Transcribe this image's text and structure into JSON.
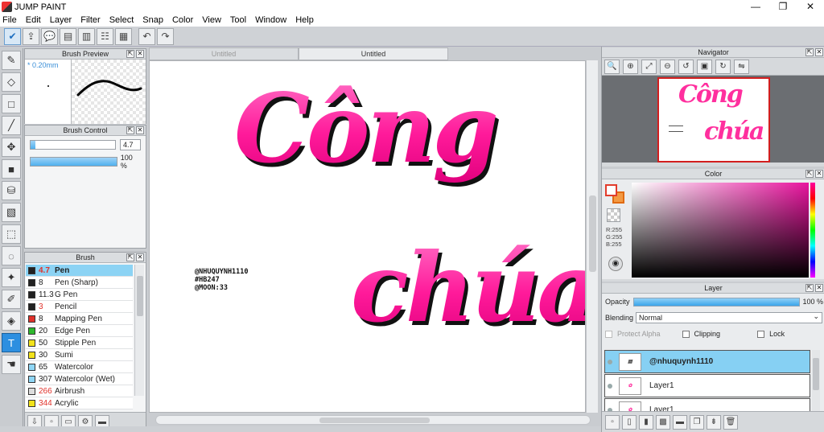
{
  "window": {
    "title": "JUMP PAINT",
    "controls": [
      "—",
      "❐",
      "✕"
    ]
  },
  "menu": [
    "File",
    "Edit",
    "Layer",
    "Filter",
    "Select",
    "Snap",
    "Color",
    "View",
    "Tool",
    "Window",
    "Help"
  ],
  "brush_preview": {
    "title": "Brush Preview",
    "size_label": "* 0.20mm"
  },
  "brush_control": {
    "title": "Brush Control",
    "size_value": "4.7",
    "size_fraction": 0.06,
    "opacity_label": "100 %",
    "opacity_fraction": 1.0
  },
  "brush_panel": {
    "title": "Brush",
    "items": [
      {
        "size": "4.7",
        "name": "Pen",
        "color": "#222222",
        "size_color": "#e0322b",
        "selected": true
      },
      {
        "size": "8",
        "name": "Pen (Sharp)",
        "color": "#222222",
        "size_color": "#222222"
      },
      {
        "size": "11.3",
        "name": "G Pen",
        "color": "#222222",
        "size_color": "#222222"
      },
      {
        "size": "3",
        "name": "Pencil",
        "color": "#222222",
        "size_color": "#e0322b"
      },
      {
        "size": "8",
        "name": "Mapping Pen",
        "color": "#e0322b",
        "size_color": "#222222"
      },
      {
        "size": "20",
        "name": "Edge Pen",
        "color": "#2db82d",
        "size_color": "#222222"
      },
      {
        "size": "50",
        "name": "Stipple Pen",
        "color": "#f2e21a",
        "size_color": "#222222"
      },
      {
        "size": "30",
        "name": "Sumi",
        "color": "#f2e21a",
        "size_color": "#222222"
      },
      {
        "size": "65",
        "name": "Watercolor",
        "color": "#8fd6f5",
        "size_color": "#222222"
      },
      {
        "size": "307",
        "name": "Watercolor (Wet)",
        "color": "#8fd6f5",
        "size_color": "#222222"
      },
      {
        "size": "266",
        "name": "Airbrush",
        "color": "#dddddd",
        "size_color": "#e0322b"
      },
      {
        "size": "344",
        "name": "Acrylic",
        "color": "#f2e21a",
        "size_color": "#e0322b"
      }
    ]
  },
  "tabs": [
    {
      "label": "Untitled",
      "active": false
    },
    {
      "label": "Untitled",
      "active": true
    }
  ],
  "canvas": {
    "watermark": [
      "@NHUQUYNH1110",
      "#HB247",
      "@MOON:33"
    ],
    "art_line1": "Công",
    "art_line2": "chúa"
  },
  "navigator": {
    "title": "Navigator",
    "thumb_line1": "Công",
    "thumb_line2": "chúa"
  },
  "color_panel": {
    "title": "Color",
    "r": "R:255",
    "g": "G:255",
    "b": "B:255",
    "fg_color": "#ffffff",
    "bg_color": "#f39a43"
  },
  "layer_panel": {
    "title": "Layer",
    "opacity_label": "Opacity",
    "opacity_value": "100 %",
    "opacity_fraction": 1.0,
    "blending_label": "Blending",
    "blending_value": "Normal",
    "protect_alpha": "Protect Alpha",
    "clipping": "Clipping",
    "lock": "Lock",
    "layers": [
      {
        "name": "@nhuquynh1110",
        "selected": true
      },
      {
        "name": "Layer1",
        "selected": false
      },
      {
        "name": "Layer1",
        "selected": false
      }
    ]
  }
}
